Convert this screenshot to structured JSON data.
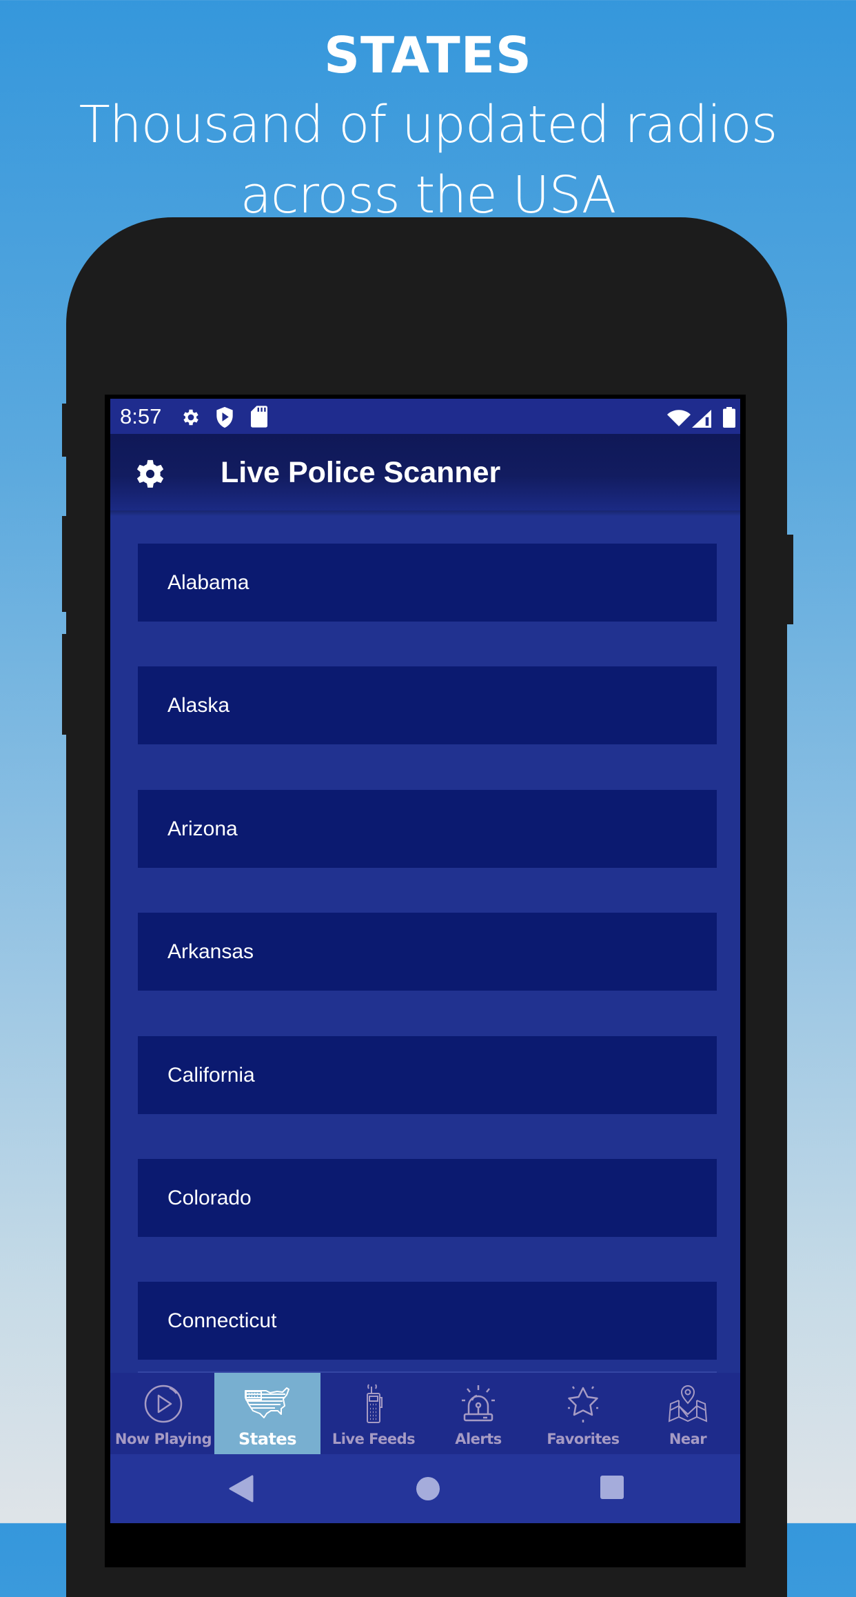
{
  "promo": {
    "title": "STATES",
    "subtitle": "Thousand of updated radios across the USA"
  },
  "status_bar": {
    "time": "8:57",
    "left_icons": [
      "settings-icon",
      "shield-play-icon",
      "sd-card-icon"
    ],
    "right_icons": [
      "wifi-icon",
      "cellular-signal-icon",
      "battery-icon"
    ]
  },
  "app_bar": {
    "title": "Live Police Scanner",
    "settings_icon": "gear-icon"
  },
  "states": [
    {
      "name": "Alabama"
    },
    {
      "name": "Alaska"
    },
    {
      "name": "Arizona"
    },
    {
      "name": "Arkansas"
    },
    {
      "name": "California"
    },
    {
      "name": "Colorado"
    },
    {
      "name": "Connecticut"
    }
  ],
  "bottom_nav": {
    "tabs": [
      {
        "label": "Now Playing",
        "icon": "play-circle-icon",
        "active": false
      },
      {
        "label": "States",
        "icon": "usa-map-icon",
        "active": true
      },
      {
        "label": "Live Feeds",
        "icon": "scanner-radio-icon",
        "active": false
      },
      {
        "label": "Alerts",
        "icon": "siren-icon",
        "active": false
      },
      {
        "label": "Favorites",
        "icon": "star-icon",
        "active": false
      },
      {
        "label": "Near",
        "icon": "map-pin-icon",
        "active": false
      }
    ]
  },
  "system_nav": {
    "buttons": [
      "back-icon",
      "home-icon",
      "recents-icon"
    ]
  },
  "colors": {
    "status_bar": "#1f2c8e",
    "app_bar": "#0f1857",
    "list_background": "#213290",
    "list_item": "#0b1a70",
    "active_tab": "#78afd0",
    "inactive_tab_text": "#a69bc4",
    "phone_body": "#1c1c1c"
  }
}
